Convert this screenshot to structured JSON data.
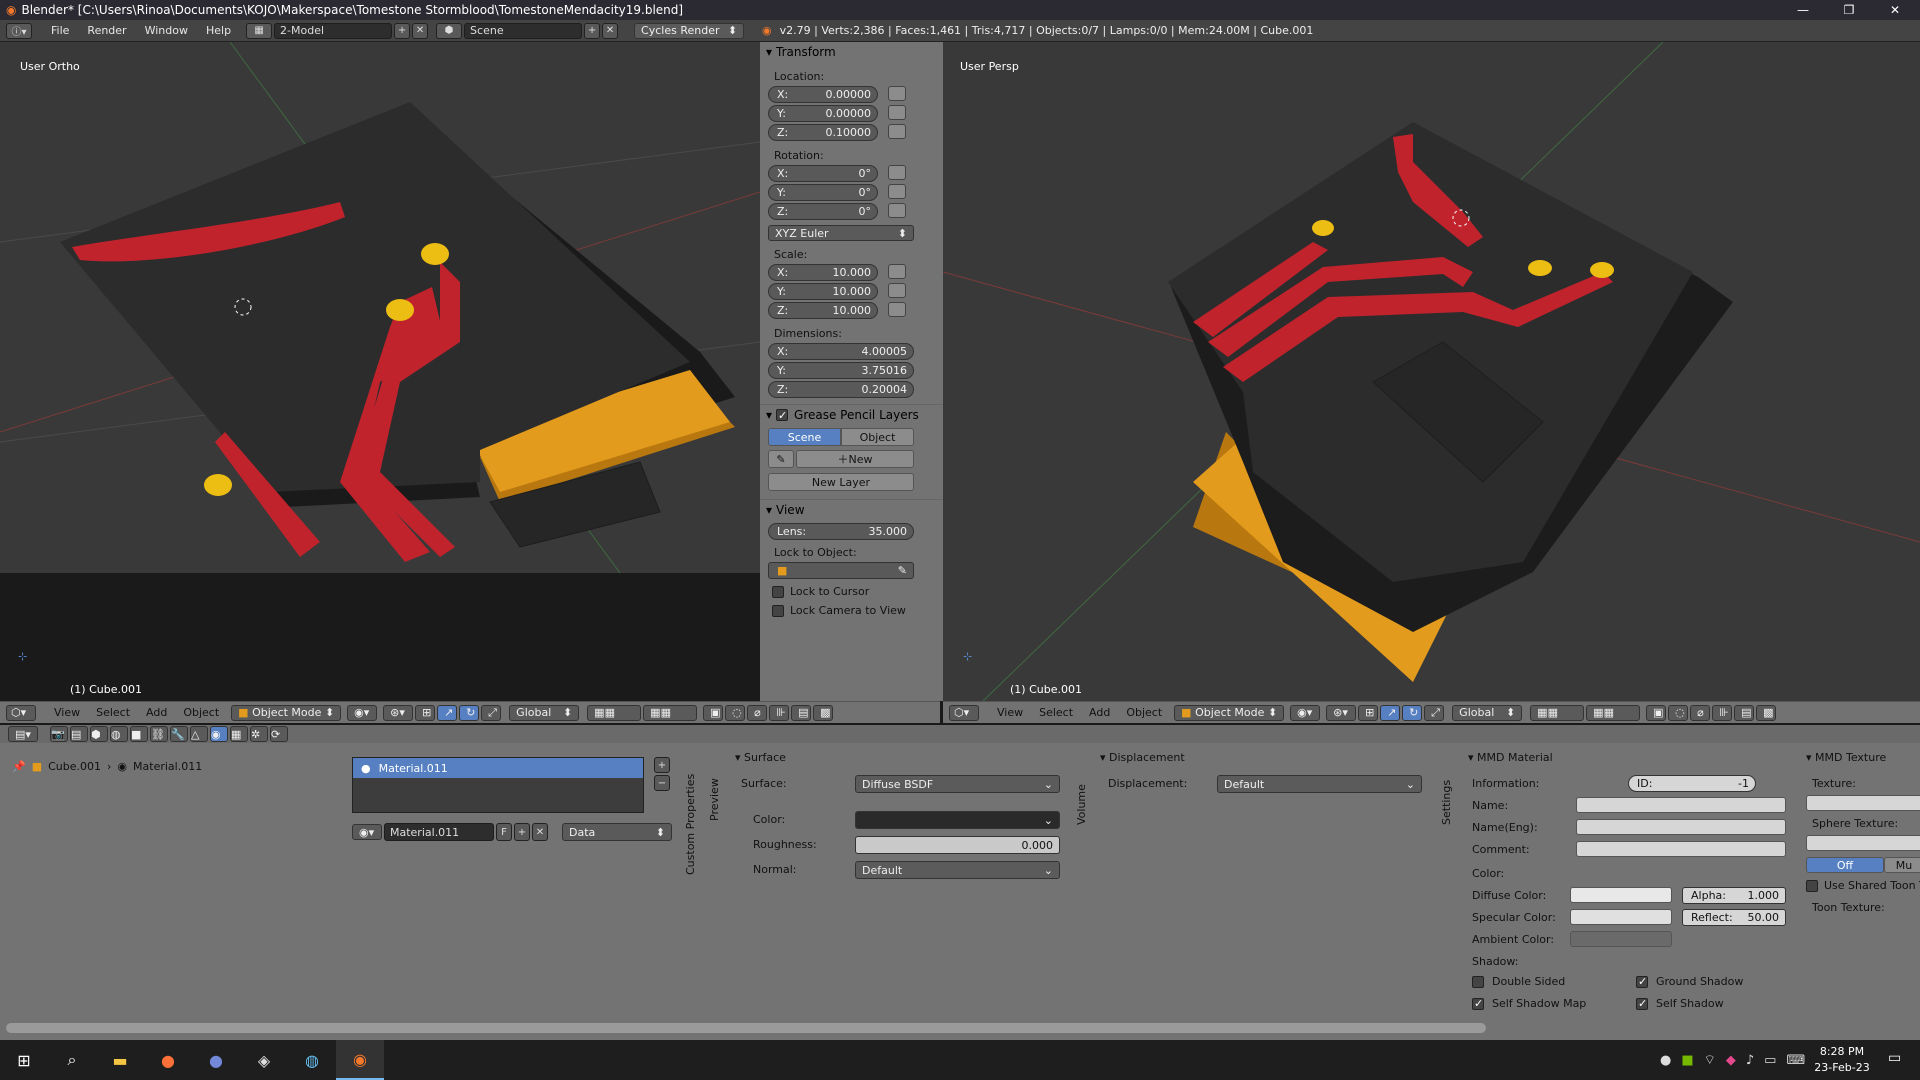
{
  "titlebar": {
    "title": "Blender* [C:\\Users\\Rinoa\\Documents\\KOJO\\Makerspace\\Tomestone Stormblood\\TomestoneMendacity19.blend]"
  },
  "infobar": {
    "menus": [
      "File",
      "Render",
      "Window",
      "Help"
    ],
    "layout": "2-Model",
    "scene": "Scene",
    "engine": "Cycles Render",
    "stats": "v2.79 | Verts:2,386 | Faces:1,461 | Tris:4,717 | Objects:0/7 | Lamps:0/0 | Mem:24.00M | Cube.001"
  },
  "left_view": {
    "label": "User Ortho",
    "object": "(1) Cube.001"
  },
  "right_view": {
    "label": "User Persp",
    "object": "(1) Cube.001"
  },
  "view_header": {
    "menus": [
      "View",
      "Select",
      "Add",
      "Object"
    ],
    "mode": "Object Mode",
    "orientation": "Global"
  },
  "npanel": {
    "transform": "Transform",
    "location_label": "Location:",
    "location": {
      "x": "0.00000",
      "y": "0.00000",
      "z": "0.10000"
    },
    "rotation_label": "Rotation:",
    "rotation": {
      "x": "0°",
      "y": "0°",
      "z": "0°"
    },
    "rotation_mode": "XYZ Euler",
    "scale_label": "Scale:",
    "scale": {
      "x": "10.000",
      "y": "10.000",
      "z": "10.000"
    },
    "dimensions_label": "Dimensions:",
    "dimensions": {
      "x": "4.00005",
      "y": "3.75016",
      "z": "0.20004"
    },
    "axis": {
      "x": "X:",
      "y": "Y:",
      "z": "Z:"
    },
    "grease": "Grease Pencil Layers",
    "scene_tab": "Scene",
    "object_tab": "Object",
    "new": "New",
    "new_layer": "New Layer",
    "view": "View",
    "lens_label": "Lens:",
    "lens": "35.000",
    "lock_to_object": "Lock to Object:",
    "lock_cursor": "Lock to Cursor",
    "lock_camera": "Lock Camera to View"
  },
  "props": {
    "breadcrumb_obj": "Cube.001",
    "breadcrumb_mat": "Material.011",
    "slot": "Material.011",
    "material_name": "Material.011",
    "f": "F",
    "link": "Data",
    "custom_props": "Custom Properties",
    "preview": "Preview",
    "surface_title": "Surface",
    "surface_label": "Surface:",
    "surface_value": "Diffuse BSDF",
    "color_label": "Color:",
    "roughness_label": "Roughness:",
    "roughness": "0.000",
    "normal_label": "Normal:",
    "normal_value": "Default",
    "volume": "Volume",
    "displacement_title": "Displacement",
    "displacement_label": "Displacement:",
    "displacement_value": "Default",
    "settings": "Settings",
    "mmd_title": "MMD Material",
    "information": "Information:",
    "id_label": "ID:",
    "id_value": "-1",
    "name": "Name:",
    "name_eng": "Name(Eng):",
    "comment": "Comment:",
    "color": "Color:",
    "diffuse": "Diffuse Color:",
    "alpha_label": "Alpha:",
    "alpha": "1.000",
    "specular": "Specular Color:",
    "reflect_label": "Reflect:",
    "reflect": "50.00",
    "ambient": "Ambient Color:",
    "shadow": "Shadow:",
    "double_sided": "Double Sided",
    "ground_shadow": "Ground Shadow",
    "self_shadow_map": "Self Shadow Map",
    "self_shadow": "Self Shadow",
    "mmd_texture": "MMD Texture",
    "texture": "Texture:",
    "sphere": "Sphere Texture:",
    "off": "Off",
    "mu": "Mu",
    "use_shared_toon": "Use Shared Toon T",
    "toon_texture": "Toon Texture:"
  },
  "taskbar": {
    "time": "8:28 PM",
    "date": "23-Feb-23"
  },
  "colors": {
    "red": "#c1232c",
    "yellow": "#ecbd13",
    "gold": "#e39b1d",
    "body": "#2c2c2c",
    "accent": "#5680c2"
  }
}
